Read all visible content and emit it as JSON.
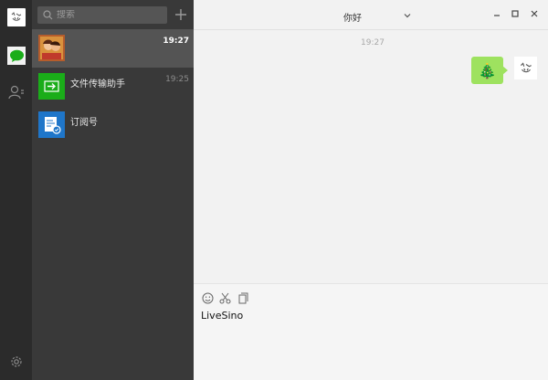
{
  "window": {
    "title": "你好"
  },
  "search": {
    "placeholder": "搜索"
  },
  "conversations": [
    {
      "name": "",
      "time": "19:27",
      "active": true
    },
    {
      "name": "文件传输助手",
      "time": "19:25"
    },
    {
      "name": "订阅号",
      "time": ""
    }
  ],
  "chat": {
    "timestamp": "19:27",
    "message_emoji": "🎄"
  },
  "composer": {
    "value": "LiveSino"
  },
  "colors": {
    "rail": "#2b2b2b",
    "list": "#393939",
    "active_item": "#545454",
    "bubble": "#9ee25f",
    "accent_green": "#1aad19",
    "accent_blue": "#1f76c9"
  },
  "icons": {
    "rail": [
      "user-avatar",
      "chat-icon",
      "contacts-icon",
      "settings-icon"
    ],
    "chat_tools": [
      "emoji-icon",
      "scissors-icon",
      "file-icon"
    ],
    "window": [
      "minimize-icon",
      "maximize-icon",
      "close-icon"
    ]
  }
}
